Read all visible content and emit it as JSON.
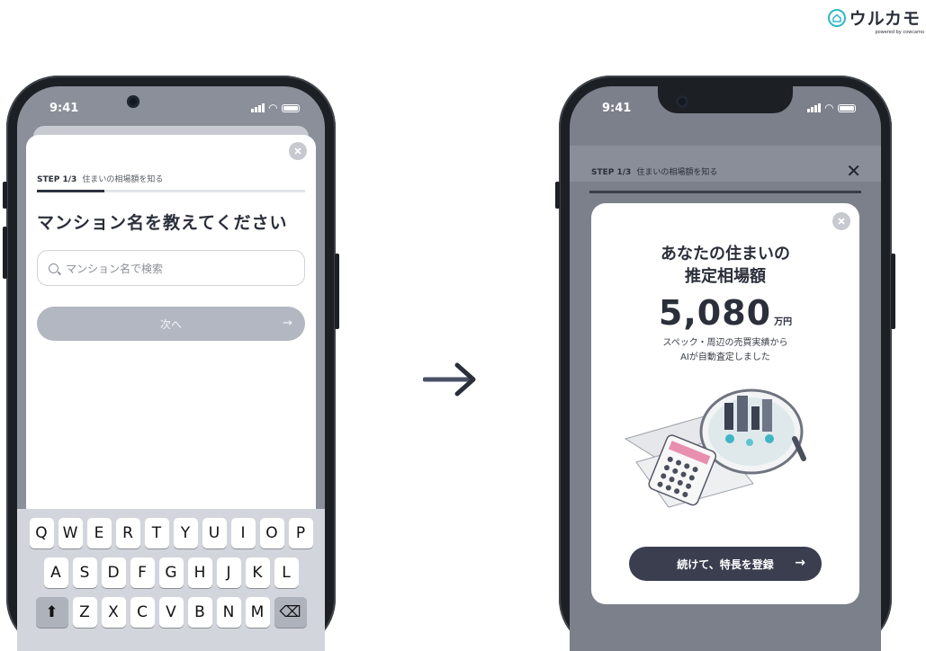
{
  "brand": {
    "name": "ウルカモ",
    "tagline": "powered by cowcamo"
  },
  "left_phone": {
    "status": {
      "time": "9:41"
    },
    "step": {
      "label": "STEP 1/3",
      "title": "住まいの相場額を知る",
      "progress": 0.25
    },
    "question": "マンション名を教えてください",
    "search": {
      "placeholder": "マンション名で検索"
    },
    "next_button": "次へ",
    "keyboard": {
      "row1": [
        "Q",
        "W",
        "E",
        "R",
        "T",
        "Y",
        "U",
        "I",
        "O",
        "P"
      ],
      "row2": [
        "A",
        "S",
        "D",
        "F",
        "G",
        "H",
        "J",
        "K",
        "L"
      ],
      "row3": [
        "Z",
        "X",
        "C",
        "V",
        "B",
        "N",
        "M"
      ]
    }
  },
  "right_phone": {
    "status": {
      "time": "9:41"
    },
    "step": {
      "label": "STEP 1/3",
      "title": "住まいの相場額を知る"
    },
    "modal": {
      "title_line1": "あなたの住まいの",
      "title_line2": "推定相場額",
      "price": "5,080",
      "unit": "万円",
      "desc_line1": "スペック・周辺の売買実績から",
      "desc_line2": "AIが自動査定しました",
      "cta": "続けて、特長を登録"
    }
  },
  "colors": {
    "accent": "#2fb8c8",
    "dark": "#3a3e4f",
    "disabled": "#b3b7c2"
  }
}
